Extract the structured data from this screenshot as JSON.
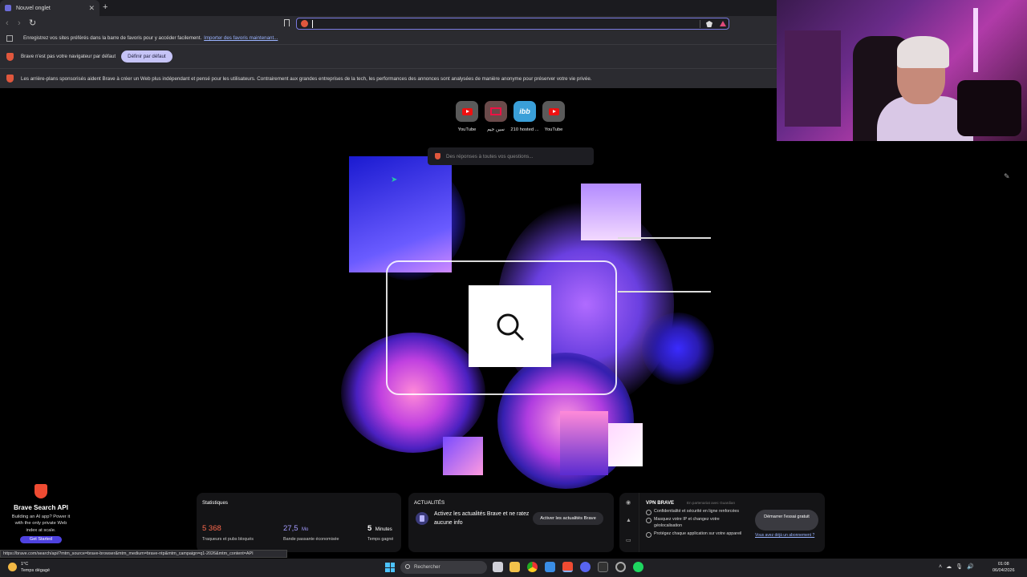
{
  "browser": {
    "tab_title": "Nouvel onglet",
    "new_tab_symbol": "+",
    "bookmarks_bar_text": "Enregistrez vos sites préférés dans la barre de favoris pour y accéder facilement.",
    "bookmarks_import_link": "Importer des favoris maintenant...",
    "default_browser_text": "Brave n'est pas votre navigateur par défaut",
    "default_browser_button": "Définir par défaut",
    "ads_notice": "Les arrière-plans sponsorisés aident Brave à créer un Web plus indépendant et pensé pour les utilisateurs. Contrairement aux grandes entreprises de la tech, les performances des annonces sont analysées de manière anonyme pour préserver votre vie privée."
  },
  "top_sites": [
    {
      "label": "YouTube",
      "icon": "youtube-icon"
    },
    {
      "label": "سين جيم",
      "icon": "site-icon"
    },
    {
      "label": "210 hosted ...",
      "icon": "ibb-icon",
      "icon_text": "ibb"
    },
    {
      "label": "YouTube",
      "icon": "youtube-icon"
    }
  ],
  "leo_search": {
    "placeholder": "Des réponses à toutes vos questions..."
  },
  "promo": {
    "title": "Brave Search API",
    "description": "Building an AI app? Power it with the only private Web index at scale.",
    "button": "Get Started"
  },
  "stats": {
    "title": "Statistiques",
    "items": [
      {
        "value": "5 368",
        "unit": "",
        "caption": "Traqueurs et pubs bloqués",
        "color": "#ff6a4d"
      },
      {
        "value": "27,5",
        "unit": "Mo",
        "caption": "Bande passante économisée",
        "color": "#a49cff"
      },
      {
        "value": "5",
        "unit": "Minutes",
        "caption": "Temps gagné",
        "color": "#ffffff"
      }
    ]
  },
  "news": {
    "title": "ACTUALITÉS",
    "text": "Activez les actualités Brave et ne ratez aucune info",
    "button": "Activer les actualités Brave"
  },
  "vpn": {
    "title": "VPN BRAVE",
    "partner": "En partenariat avec  Guardian",
    "features": [
      "Confidentialité et sécurité en ligne renforcées",
      "Masquez votre IP et changez votre géolocalisation",
      "Protégez chaque application sur votre appareil"
    ],
    "button": "Démarrer l'essai gratuit",
    "link": "Vous avez déjà un abonnement ?"
  },
  "status_url": "https://brave.com/search/api/?mtm_source=brave-browser&mtm_medium=brave-ntp&mtm_campaign=q1-2026&mtm_content=API",
  "taskbar": {
    "weather_temp": "1°C",
    "weather_desc": "Temps dégagé",
    "search_placeholder": "Rechercher",
    "time": "01:08",
    "date": "06/04/2026"
  },
  "colors": {
    "accent": "#7a7ae0",
    "brave_orange": "#ef4b32"
  }
}
